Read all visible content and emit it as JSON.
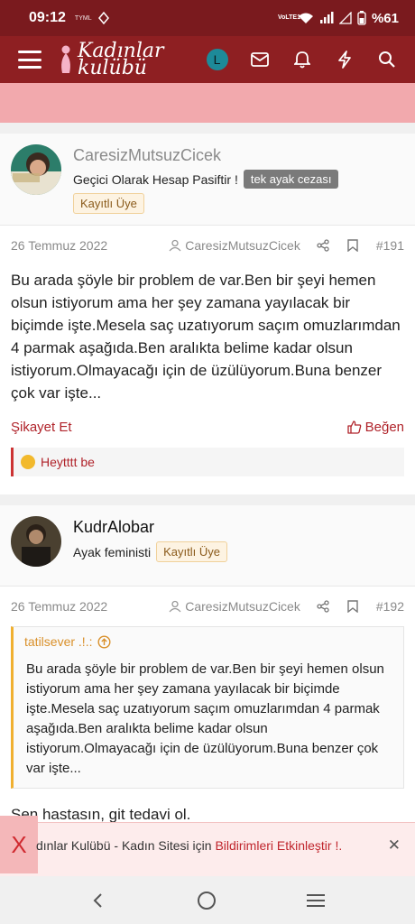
{
  "status_bar": {
    "time": "09:12",
    "carrier_hint": "TYML",
    "net_label": "VoLTE1",
    "battery": "%61"
  },
  "header": {
    "logo_line1": "Kadınlar",
    "logo_line2": "kulübü",
    "avatar_letter": "L",
    "colors": {
      "bar": "#8e1f22",
      "status": "#7a1a1e",
      "accent": "#b0232a"
    }
  },
  "posts": [
    {
      "username": "CaresizMutsuzCicek",
      "user_title": "Geçici Olarak Hesap Pasiftir !",
      "extra_badge": "tek ayak cezası",
      "role_badge": "Kayıtlı Üye",
      "date": "26 Temmuz 2022",
      "author_ref": "CaresizMutsuzCicek",
      "post_number": "#191",
      "body": "Bu arada şöyle bir problem de var.Ben bir şeyi hemen olsun istiyorum ama her şey zamana yayılacak bir biçimde işte.Mesela saç uzatıyorum saçım omuzlarımdan 4 parmak aşağıda.Ben aralıkta belime kadar olsun istiyorum.Olmayacağı için de üzülüyorum.Buna benzer çok var işte...",
      "report_label": "Şikayet Et",
      "like_label": "Beğen",
      "reaction_user": "Heytttt be"
    },
    {
      "username": "KudrAlobar",
      "user_title": "Ayak feministi",
      "role_badge": "Kayıtlı Üye",
      "date": "26 Temmuz 2022",
      "author_ref": "CaresizMutsuzCicek",
      "post_number": "#192",
      "quote_author": "tatilsever .!.:",
      "quote_text": "Bu arada şöyle bir problem de var.Ben bir şeyi hemen olsun istiyorum ama her şey zamana yayılacak bir biçimde işte.Mesela saç uzatıyorum saçım omuzlarımdan 4 parmak aşağıda.Ben aralıkta belime kadar olsun istiyorum.Olmayacağı için de üzülüyorum.Buna benzer çok var işte...",
      "reply_text": "Sen hastasın, git tedavi ol."
    }
  ],
  "notification": {
    "close_x": "X",
    "text_prefix": "dınlar Kulübü - Kadın Sitesi için ",
    "link_text": "Bildirimleri Etkinleştir !.",
    "dismiss": "✕"
  }
}
